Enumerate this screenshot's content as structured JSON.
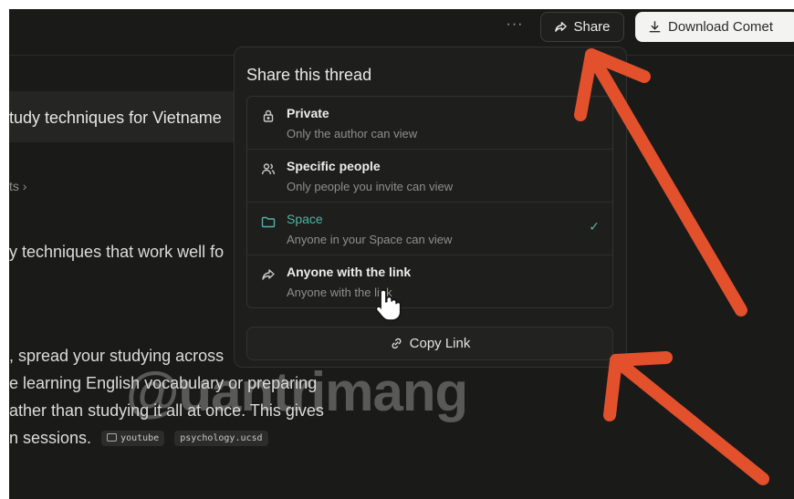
{
  "header": {
    "more_label": "···",
    "share_label": "Share",
    "download_label": "Download Comet"
  },
  "thread": {
    "query_text": "tudy techniques for Vietname",
    "sources_text": "ts  ›",
    "answer_lines": [
      "y techniques that work well fo",
      ", spread your studying across",
      "e learning English vocabulary or preparing",
      "ather than studying it all at once. This gives",
      "n sessions."
    ],
    "citations": [
      "youtube",
      "psychology.ucsd"
    ]
  },
  "share_popover": {
    "title": "Share this thread",
    "options": [
      {
        "label": "Private",
        "description": "Only the author can view",
        "icon": "lock-icon",
        "selected": false
      },
      {
        "label": "Specific people",
        "description": "Only people you invite can view",
        "icon": "people-icon",
        "selected": false
      },
      {
        "label": "Space",
        "description": "Anyone in your Space can view",
        "icon": "folder-icon",
        "selected": true
      },
      {
        "label": "Anyone with the link",
        "description": "Anyone with the link",
        "icon": "share-arrow-icon",
        "selected": false
      }
    ],
    "copy_link_label": "Copy Link"
  },
  "watermark_text": "@uantrimang",
  "colors": {
    "background": "#1a1a19",
    "accent": "#4fb3a6",
    "annotation_arrow": "#e2502c"
  }
}
